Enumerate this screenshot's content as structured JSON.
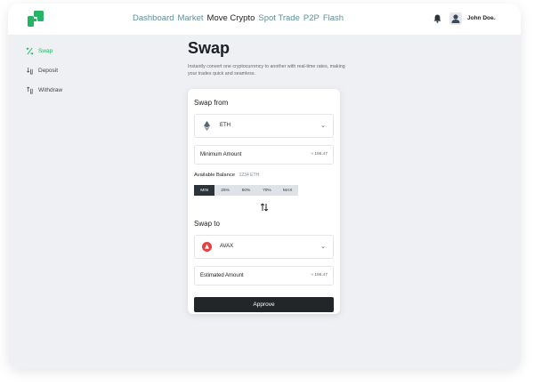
{
  "nav": {
    "items": [
      "Dashboard",
      "Market",
      "Move Crypto",
      "Spot Trade",
      "P2P",
      "Flash"
    ],
    "active": "Move Crypto"
  },
  "user": {
    "name": "John Doe"
  },
  "sidebar": {
    "items": [
      {
        "label": "Swap",
        "icon": "swap-icon",
        "active": true
      },
      {
        "label": "Deposit",
        "icon": "deposit-icon",
        "active": false
      },
      {
        "label": "Withdraw",
        "icon": "withdraw-icon",
        "active": false
      }
    ]
  },
  "page": {
    "title": "Swap",
    "description": "Instantly convert one cryptocurrency to another with real-time rates, making your trades quick and seamless."
  },
  "swap_from": {
    "label": "Swap from",
    "coin": "ETH",
    "min_label": "Minimum  Amount",
    "min_value": "≈ 198.47",
    "balance_label": "Available Balance",
    "balance_value": "1234 ETH",
    "percent_options": [
      "MIN",
      "25%",
      "50%",
      "70%",
      "MAX"
    ],
    "percent_selected": "MIN"
  },
  "swap_to": {
    "label": "Swap to",
    "coin": "AVAX",
    "est_label": "Estimated Amount",
    "est_value": "≈ 198.47"
  },
  "approve_label": "Approve",
  "colors": {
    "accent": "#25b365",
    "button_dark": "#232629",
    "avax_red": "#e84142"
  }
}
